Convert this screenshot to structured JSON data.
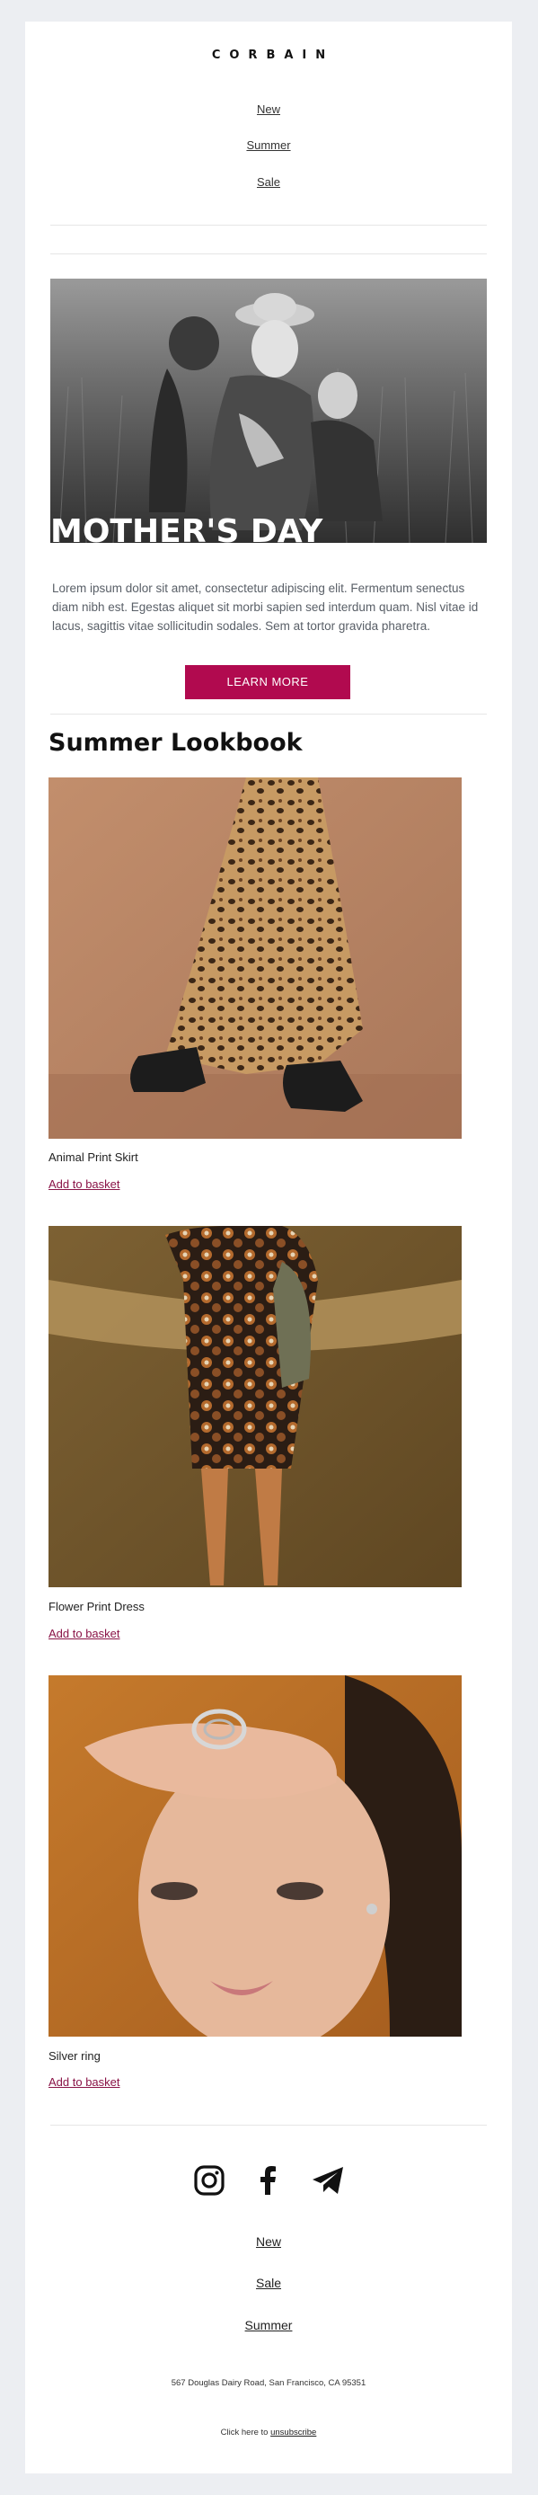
{
  "brand": "CORBAIN",
  "top_nav": [
    "New",
    "Summer",
    "Sale"
  ],
  "hero": {
    "title": "MOTHER'S DAY",
    "body": "Lorem ipsum dolor sit amet, consectetur adipiscing elit. Fermentum senectus diam nibh est. Egestas aliquet sit morbi sapien sed interdum quam. Nisl vitae id lacus, sagittis vitae sollicitudin sodales. Sem at tortor gravida pharetra.",
    "cta_label": "LEARN MORE"
  },
  "lookbook": {
    "title": "Summer Lookbook",
    "products": [
      {
        "name": "Animal Print Skirt",
        "link": "Add to basket"
      },
      {
        "name": "Flower Print Dress",
        "link": "Add to basket"
      },
      {
        "name": "Silver ring",
        "link": "Add to basket"
      }
    ]
  },
  "social_icons": [
    "instagram-icon",
    "facebook-icon",
    "telegram-icon"
  ],
  "footer_nav": [
    "New",
    "Sale",
    "Summer"
  ],
  "footer": {
    "address": "567 Douglas Dairy Road, San Francisco, CA 95351",
    "unsubscribe_prefix": "Click here to ",
    "unsubscribe_link": "unsubscribe"
  },
  "colors": {
    "accent": "#b10a4f",
    "link": "#8a1447",
    "background": "#eceef2",
    "card": "#ffffff"
  }
}
